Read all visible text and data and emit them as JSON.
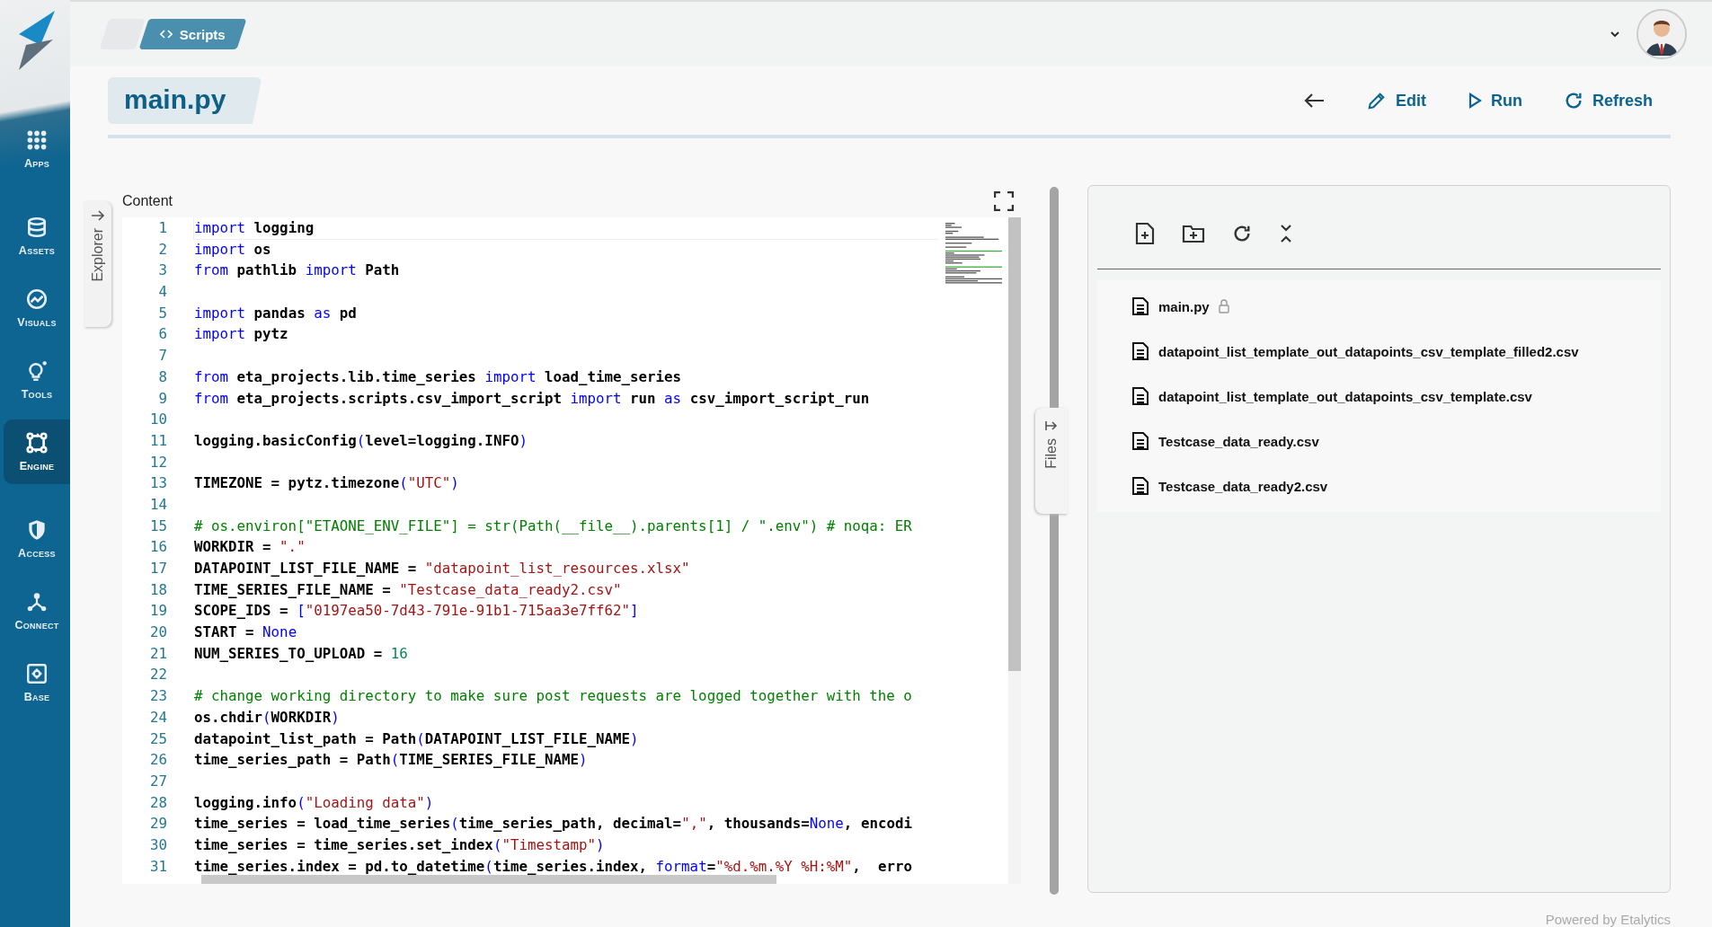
{
  "sidebar": {
    "nav_groups": [
      {
        "items": [
          {
            "label": "Apps",
            "selected": false
          }
        ]
      },
      {
        "items": [
          {
            "label": "Assets",
            "selected": false
          },
          {
            "label": "Visuals",
            "selected": false
          },
          {
            "label": "Tools",
            "selected": false
          },
          {
            "label": "Engine",
            "selected": true
          }
        ]
      },
      {
        "items": [
          {
            "label": "Access",
            "selected": false
          },
          {
            "label": "Connect",
            "selected": false
          },
          {
            "label": "Base",
            "selected": false
          }
        ]
      }
    ]
  },
  "breadcrumb": {
    "label": "Scripts"
  },
  "page": {
    "title": "main.py",
    "actions": [
      {
        "kind": "back"
      },
      {
        "kind": "edit",
        "label": "Edit"
      },
      {
        "kind": "run",
        "label": "Run"
      },
      {
        "kind": "refresh",
        "label": "Refresh"
      }
    ]
  },
  "explorer_tab": {
    "label": "Explorer"
  },
  "editor": {
    "label": "Content",
    "lines": [
      {
        "n": "1",
        "tokens": [
          {
            "kind": "kw",
            "text": "import"
          },
          {
            "kind": "plain",
            "text": " logging"
          }
        ]
      },
      {
        "n": "2",
        "tokens": [
          {
            "kind": "kw",
            "text": "import"
          },
          {
            "kind": "plain",
            "text": " os"
          }
        ]
      },
      {
        "n": "3",
        "tokens": [
          {
            "kind": "kw",
            "text": "from"
          },
          {
            "kind": "plain",
            "text": " pathlib "
          },
          {
            "kind": "kw",
            "text": "import"
          },
          {
            "kind": "plain",
            "text": " Path"
          }
        ]
      },
      {
        "n": "4"
      },
      {
        "n": "5",
        "tokens": [
          {
            "kind": "kw",
            "text": "import"
          },
          {
            "kind": "plain",
            "text": " pandas "
          },
          {
            "kind": "kw",
            "text": "as"
          },
          {
            "kind": "plain",
            "text": " pd"
          }
        ]
      },
      {
        "n": "6",
        "tokens": [
          {
            "kind": "kw",
            "text": "import"
          },
          {
            "kind": "plain",
            "text": " pytz"
          }
        ]
      },
      {
        "n": "7"
      },
      {
        "n": "8",
        "tokens": [
          {
            "kind": "kw",
            "text": "from"
          },
          {
            "kind": "plain",
            "text": " eta_projects.lib.time_series "
          },
          {
            "kind": "kw",
            "text": "import"
          },
          {
            "kind": "plain",
            "text": " load_time_series"
          }
        ]
      },
      {
        "n": "9",
        "tokens": [
          {
            "kind": "kw",
            "text": "from"
          },
          {
            "kind": "plain",
            "text": " eta_projects.scripts.csv_import_script "
          },
          {
            "kind": "kw",
            "text": "import"
          },
          {
            "kind": "plain",
            "text": " run "
          },
          {
            "kind": "kw",
            "text": "as"
          },
          {
            "kind": "plain",
            "text": " csv_import_script_run"
          }
        ]
      },
      {
        "n": "10"
      },
      {
        "n": "11",
        "tokens": [
          {
            "kind": "plain",
            "text": "logging.basicConfig"
          },
          {
            "kind": "kw",
            "text": "("
          },
          {
            "kind": "plain",
            "text": "level=logging.INFO"
          },
          {
            "kind": "kw",
            "text": ")"
          }
        ]
      },
      {
        "n": "12"
      },
      {
        "n": "13",
        "tokens": [
          {
            "kind": "plain",
            "text": "TIMEZONE = pytz.timezone"
          },
          {
            "kind": "kw",
            "text": "("
          },
          {
            "kind": "str",
            "text": "\"UTC\""
          },
          {
            "kind": "kw",
            "text": ")"
          }
        ]
      },
      {
        "n": "14"
      },
      {
        "n": "15",
        "tokens": [
          {
            "kind": "comment",
            "text": "# os.environ[\"ETAONE_ENV_FILE\"] = str(Path(__file__).parents[1] / \".env\") # noqa: ER"
          }
        ]
      },
      {
        "n": "16",
        "tokens": [
          {
            "kind": "plain",
            "text": "WORKDIR = "
          },
          {
            "kind": "str",
            "text": "\".\""
          }
        ]
      },
      {
        "n": "17",
        "tokens": [
          {
            "kind": "plain",
            "text": "DATAPOINT_LIST_FILE_NAME = "
          },
          {
            "kind": "str",
            "text": "\"datapoint_list_resources.xlsx\""
          }
        ]
      },
      {
        "n": "18",
        "tokens": [
          {
            "kind": "plain",
            "text": "TIME_SERIES_FILE_NAME = "
          },
          {
            "kind": "str",
            "text": "\"Testcase_data_ready2.csv\""
          }
        ]
      },
      {
        "n": "19",
        "tokens": [
          {
            "kind": "plain",
            "text": "SCOPE_IDS = "
          },
          {
            "kind": "kw",
            "text": "["
          },
          {
            "kind": "str",
            "text": "\"0197ea50-7d43-791e-91b1-715aa3e7ff62\""
          },
          {
            "kind": "kw",
            "text": "]"
          }
        ]
      },
      {
        "n": "20",
        "tokens": [
          {
            "kind": "plain",
            "text": "START = "
          },
          {
            "kind": "kw",
            "text": "None"
          }
        ]
      },
      {
        "n": "21",
        "tokens": [
          {
            "kind": "plain",
            "text": "NUM_SERIES_TO_UPLOAD = "
          },
          {
            "kind": "num",
            "text": "16"
          }
        ]
      },
      {
        "n": "22"
      },
      {
        "n": "23",
        "tokens": [
          {
            "kind": "comment",
            "text": "# change working directory to make sure post requests are logged together with the o"
          }
        ]
      },
      {
        "n": "24",
        "tokens": [
          {
            "kind": "plain",
            "text": "os.chdir"
          },
          {
            "kind": "kw",
            "text": "("
          },
          {
            "kind": "plain",
            "text": "WORKDIR"
          },
          {
            "kind": "kw",
            "text": ")"
          }
        ]
      },
      {
        "n": "25",
        "tokens": [
          {
            "kind": "plain",
            "text": "datapoint_list_path = Path"
          },
          {
            "kind": "kw",
            "text": "("
          },
          {
            "kind": "plain",
            "text": "DATAPOINT_LIST_FILE_NAME"
          },
          {
            "kind": "kw",
            "text": ")"
          }
        ]
      },
      {
        "n": "26",
        "tokens": [
          {
            "kind": "plain",
            "text": "time_series_path = Path"
          },
          {
            "kind": "kw",
            "text": "("
          },
          {
            "kind": "plain",
            "text": "TIME_SERIES_FILE_NAME"
          },
          {
            "kind": "kw",
            "text": ")"
          }
        ]
      },
      {
        "n": "27"
      },
      {
        "n": "28",
        "tokens": [
          {
            "kind": "plain",
            "text": "logging.info"
          },
          {
            "kind": "kw",
            "text": "("
          },
          {
            "kind": "str",
            "text": "\"Loading data\""
          },
          {
            "kind": "kw",
            "text": ")"
          }
        ]
      },
      {
        "n": "29",
        "tokens": [
          {
            "kind": "plain",
            "text": "time_series = load_time_series"
          },
          {
            "kind": "kw",
            "text": "("
          },
          {
            "kind": "plain",
            "text": "time_series_path, decimal="
          },
          {
            "kind": "str",
            "text": "\",\""
          },
          {
            "kind": "plain",
            "text": ", thousands="
          },
          {
            "kind": "kw",
            "text": "None"
          },
          {
            "kind": "plain",
            "text": ", encodi"
          }
        ]
      },
      {
        "n": "30",
        "tokens": [
          {
            "kind": "plain",
            "text": "time_series = time_series.set_index"
          },
          {
            "kind": "kw",
            "text": "("
          },
          {
            "kind": "str",
            "text": "\"Timestamp\""
          },
          {
            "kind": "kw",
            "text": ")"
          }
        ]
      },
      {
        "n": "31",
        "tokens": [
          {
            "kind": "plain",
            "text": "time_series.index = pd.to_datetime"
          },
          {
            "kind": "kw",
            "text": "("
          },
          {
            "kind": "plain",
            "text": "time_series.index, "
          },
          {
            "kind": "kw",
            "text": "format"
          },
          {
            "kind": "plain",
            "text": "="
          },
          {
            "kind": "str",
            "text": "\"%d.%m.%Y %H:%M\""
          },
          {
            "kind": "plain",
            "text": ",  erro"
          }
        ]
      }
    ]
  },
  "files_tab": {
    "label": "Files"
  },
  "files": {
    "toolbar": [
      {
        "kind": "new-file"
      },
      {
        "kind": "new-folder"
      },
      {
        "kind": "refresh"
      },
      {
        "kind": "collapse"
      }
    ],
    "items": [
      {
        "name": "main.py",
        "locked": true
      },
      {
        "name": "datapoint_list_template_out_datapoints_csv_template_filled2.csv",
        "locked": false
      },
      {
        "name": "datapoint_list_template_out_datapoints_csv_template.csv",
        "locked": false
      },
      {
        "name": "Testcase_data_ready.csv",
        "locked": false
      },
      {
        "name": "Testcase_data_ready2.csv",
        "locked": false
      }
    ]
  },
  "footer": {
    "text": "Powered by Etalytics"
  }
}
